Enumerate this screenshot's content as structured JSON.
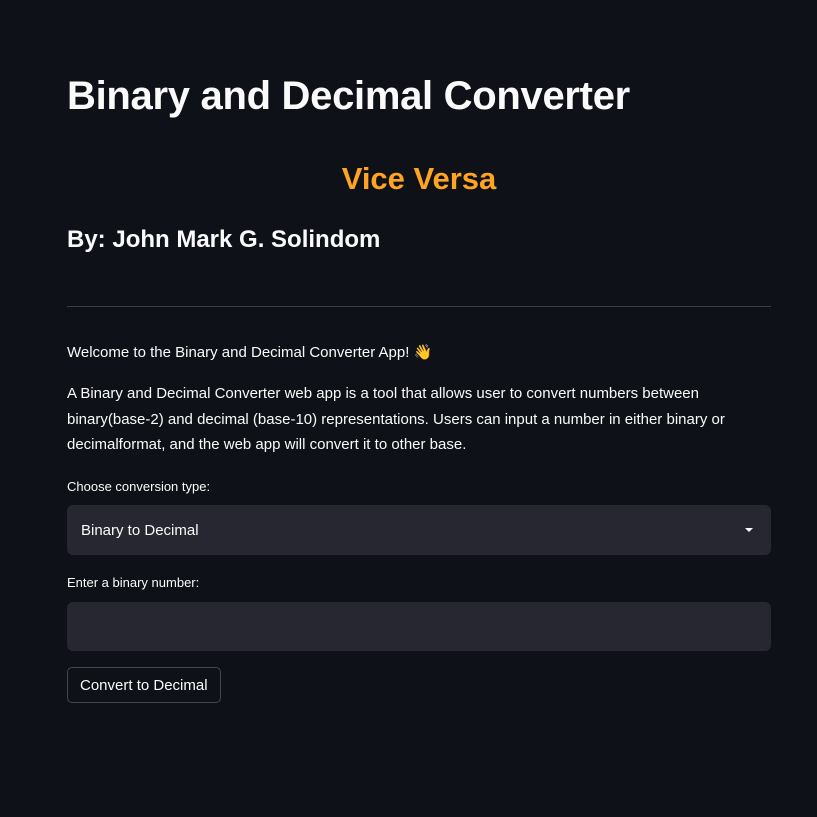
{
  "header": {
    "title": "Binary and Decimal Converter",
    "subtitle": "Vice Versa",
    "byline": "By: John Mark G. Solindom"
  },
  "intro": {
    "welcome": "Welcome to the Binary and Decimal Converter App!",
    "welcome_emoji": "👋",
    "description": "A Binary and Decimal Converter web app is a tool that allows user to convert numbers between binary(base-2) and decimal (base-10) representations. Users can input a number in either binary or decimalformat, and the web app will convert it to other base."
  },
  "form": {
    "conversion_label": "Choose conversion type:",
    "conversion_selected": "Binary to Decimal",
    "input_label": "Enter a binary number:",
    "input_value": "",
    "button_label": "Convert to Decimal"
  },
  "colors": {
    "background": "#0e1117",
    "accent": "#ffa421",
    "widget_bg": "#262730"
  },
  "icons": {
    "dropdown": "chevron-down-icon"
  }
}
